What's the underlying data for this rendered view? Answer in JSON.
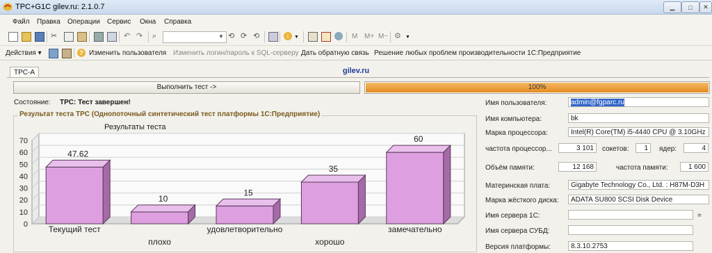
{
  "window": {
    "title": "TPC+G1C gilev.ru: 2.1.0.7"
  },
  "menu": [
    "Файл",
    "Правка",
    "Операции",
    "Сервис",
    "Окна",
    "Справка"
  ],
  "actions": {
    "actions_menu": "Действия",
    "change_user": "Изменить пользователя",
    "change_login": "Изменить логин/пароль к SQL-серверу",
    "feedback": "Дать обратную связь",
    "solution": "Решение любых проблем производительности 1С:Предприятие"
  },
  "tab": {
    "label": "TPC-A",
    "site": "gilev.ru"
  },
  "run_button": "Выполнить тест ->",
  "progress": {
    "text": "100%",
    "value": 100
  },
  "status": {
    "label": "Состояние:",
    "value": "TPC: Тест завершен!"
  },
  "group_title": "Результат теста TPC (Однопоточный синтетический тест платформы 1С:Предприятие)",
  "chart_data": {
    "type": "bar",
    "title": "Результаты теста",
    "categories": [
      "Текущий тест",
      "плохо",
      "удовлетворительно",
      "хорошо",
      "замечательно"
    ],
    "values": [
      47.62,
      10,
      15,
      35,
      60
    ],
    "value_labels": [
      "47.62",
      "10",
      "15",
      "35",
      "60"
    ],
    "yticks": [
      "0",
      "10",
      "20",
      "30",
      "40",
      "50",
      "60",
      "70"
    ],
    "ylim": [
      0,
      70
    ],
    "bar_color": "#dd9fe0",
    "grid": true
  },
  "info": {
    "user_label": "Имя пользователя:",
    "user_value": "admin@fgparc.ru",
    "computer_label": "Имя компьютера:",
    "computer_value": "bk",
    "cpu_label": "Марка процессора:",
    "cpu_value": "Intel(R) Core(TM) i5-4440 CPU @ 3.10GHz",
    "freq_label": "частота процессор...",
    "freq_value": "3 101",
    "sockets_label": "сокетов:",
    "sockets_value": "1",
    "cores_label": "ядер:",
    "cores_value": "4",
    "mem_label": "Объём памяти:",
    "mem_value": "12 168",
    "memfreq_label": "частота памяти:",
    "memfreq_value": "1 600",
    "board_label": "Материнская плата:",
    "board_value": "Gigabyte Technology Co., Ltd. : H87M-D3H",
    "disk_label": "Марка жёсткого диска:",
    "disk_value": "ADATA SU800 SCSI Disk Device",
    "server1c_label": "Имя сервера 1С:",
    "server1c_value": "",
    "server1c_suffix": "=",
    "dbms_label": "Имя сервера СУБД:",
    "dbms_value": "",
    "platform_label": "Версия платформы:",
    "platform_value": "8.3.10.2753"
  }
}
